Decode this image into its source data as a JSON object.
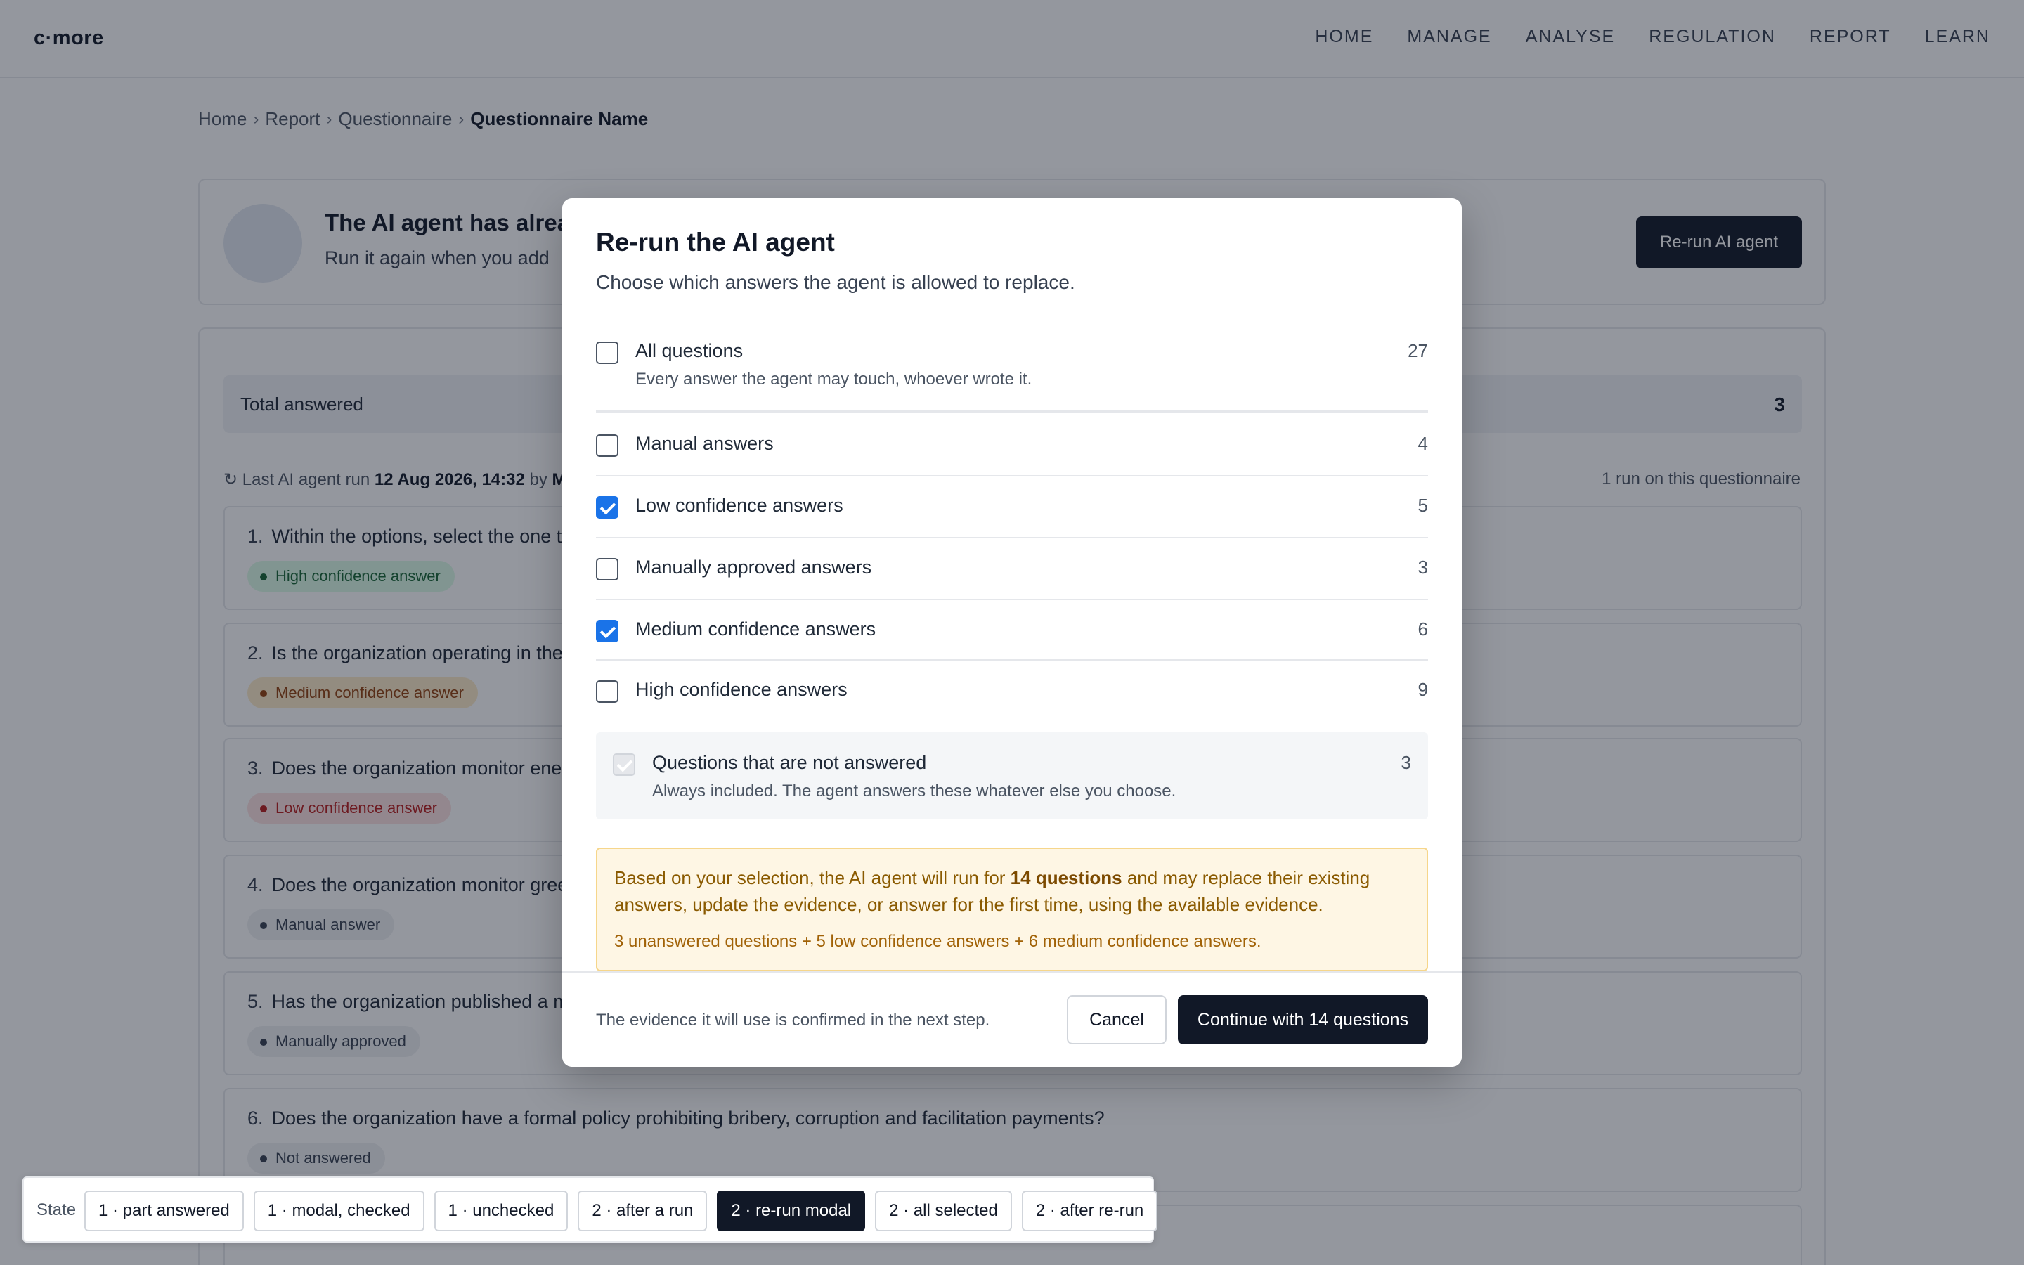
{
  "app": {
    "logo": "c·more",
    "nav": [
      "HOME",
      "MANAGE",
      "ANALYSE",
      "REGULATION",
      "REPORT",
      "LEARN"
    ]
  },
  "breadcrumb": {
    "items": [
      "Home",
      "Report",
      "Questionnaire"
    ],
    "separator": "›",
    "current": "Questionnaire Name"
  },
  "hero": {
    "title": "The AI agent has alrea",
    "subtitle": "Run it again when you add",
    "rerun_label": "Re-run AI agent"
  },
  "summary": {
    "total_label": "Total answered",
    "total_value": "3",
    "last_run_icon": "↻",
    "last_run_prefix": "Last AI agent run",
    "last_run_date": "12 Aug 2026, 14:32",
    "last_run_by": "by",
    "last_run_by_initial": "M",
    "run_count": "1 run on this questionnaire"
  },
  "questions": [
    {
      "num": "1.",
      "text": "Within the options, select the one tha",
      "badge": "High confidence answer",
      "kind": "high"
    },
    {
      "num": "2.",
      "text": "Is the organization operating in the fo",
      "badge": "Medium confidence answer",
      "kind": "med"
    },
    {
      "num": "3.",
      "text": "Does the organization monitor energ",
      "badge": "Low confidence answer",
      "kind": "low"
    },
    {
      "num": "4.",
      "text": "Does the organization monitor greer",
      "badge": "Manual answer",
      "kind": "man"
    },
    {
      "num": "5.",
      "text": "Has the organization published a mo",
      "badge": "Manually approved",
      "kind": "man"
    },
    {
      "num": "6.",
      "text": "Does the organization have a formal policy prohibiting bribery, corruption and facilitation payments?",
      "badge": "Not answered",
      "kind": "man"
    }
  ],
  "modal": {
    "title": "Re-run the AI agent",
    "subtitle": "Choose which answers the agent is allowed to replace.",
    "all": {
      "label": "All questions",
      "desc": "Every answer the agent may touch, whoever wrote it.",
      "count": "27",
      "checked": false
    },
    "options": [
      {
        "label": "Manual answers",
        "count": "4",
        "checked": false
      },
      {
        "label": "Low confidence answers",
        "count": "5",
        "checked": true
      },
      {
        "label": "Manually approved answers",
        "count": "3",
        "checked": false
      },
      {
        "label": "Medium confidence answers",
        "count": "6",
        "checked": true
      },
      {
        "label": "High confidence answers",
        "count": "9",
        "checked": false
      }
    ],
    "always": {
      "label": "Questions that are not answered",
      "desc": "Always included. The agent answers these whatever else you choose.",
      "count": "3"
    },
    "notice": {
      "before": "Based on your selection, the AI agent will run for ",
      "bold": "14 questions",
      "after": " and may replace their existing answers, update the evidence, or answer for the first time, using the available evidence.",
      "breakdown": "3 unanswered questions + 5 low confidence answers + 6 medium confidence answers."
    },
    "footer_hint": "The evidence it will use is confirmed in the next step.",
    "cancel_label": "Cancel",
    "continue_label": "Continue with 14 questions"
  },
  "statebar": {
    "label": "State",
    "chips": [
      "1 · part answered",
      "1 · modal, checked",
      "1 · unchecked",
      "2 · after a run",
      "2 · re-run modal",
      "2 · all selected",
      "2 · after re-run"
    ],
    "active_index": 4
  },
  "colors": {
    "primary_dark": "#111827",
    "checkbox_blue": "#1a73e8",
    "notice_bg": "#fef6e4",
    "notice_text": "#8a5a00"
  }
}
